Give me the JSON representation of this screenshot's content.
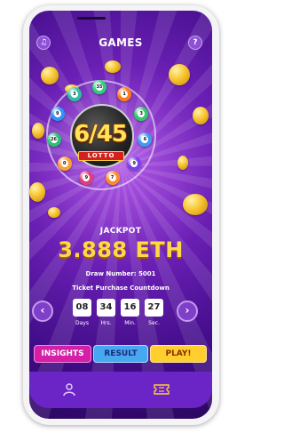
{
  "header": {
    "title": "GAMES",
    "left_icon": "music-icon",
    "right_label": "?"
  },
  "logo": {
    "number": "6/45",
    "ribbon": "LOTTO"
  },
  "balls": [
    {
      "label": "35",
      "color": "#2bd17e"
    },
    {
      "label": "1",
      "color": "#ff7a1a"
    },
    {
      "label": "3",
      "color": "#30c86a"
    },
    {
      "label": "6",
      "color": "#3f9af2"
    },
    {
      "label": "9",
      "color": "#7c3ff0"
    },
    {
      "label": "7",
      "color": "#ff8a2e"
    },
    {
      "label": "9",
      "color": "#e33c7a"
    },
    {
      "label": "0",
      "color": "#ff9f33"
    },
    {
      "label": "26",
      "color": "#2ac07b"
    },
    {
      "label": "9",
      "color": "#2f92ff"
    },
    {
      "label": "3",
      "color": "#2bc0a6"
    }
  ],
  "jackpot": {
    "label": "JACKPOT",
    "value": "3.888 ETH"
  },
  "draw_number": "Draw Number: 5001",
  "countdown": {
    "title": "Ticket Purchase Countdown",
    "items": [
      {
        "value": "08",
        "label": "Days"
      },
      {
        "value": "34",
        "label": "Hrs."
      },
      {
        "value": "16",
        "label": "Min."
      },
      {
        "value": "27",
        "label": "Sec."
      }
    ],
    "prev_label": "‹",
    "next_label": "›"
  },
  "buttons": {
    "insights": "INSIGHTS",
    "result": "RESULT",
    "play": "PLAY!"
  },
  "bottom_nav": {
    "items": [
      {
        "icon": "user-icon"
      },
      {
        "icon": "ticket-icon"
      }
    ]
  },
  "colors": {
    "accent": "#6b24c6",
    "gold": "#ffd84a"
  }
}
